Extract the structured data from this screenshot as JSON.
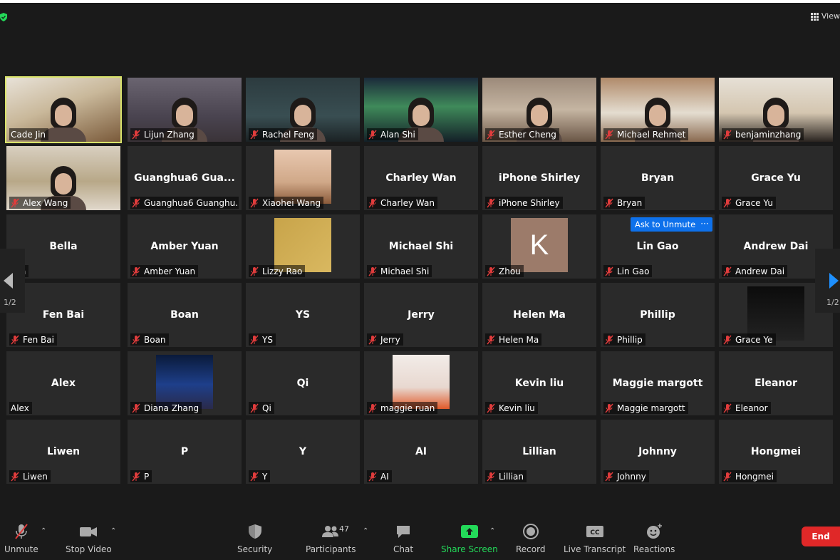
{
  "top_bar": {
    "view_label": "View"
  },
  "pagination": {
    "left_page": "1/2",
    "right_page": "1/2"
  },
  "ask_to_unmute": {
    "label": "Ask to Unmute",
    "more_label": "···"
  },
  "tiles": [
    {
      "name": "Cade Jin",
      "big": "",
      "video": true,
      "muted": false
    },
    {
      "name": "Lijun Zhang",
      "big": "",
      "video": true,
      "muted": true
    },
    {
      "name": "Rachel Feng",
      "big": "",
      "video": true,
      "muted": true
    },
    {
      "name": "Alan Shi",
      "big": "",
      "video": true,
      "muted": true
    },
    {
      "name": "Esther Cheng",
      "big": "",
      "video": true,
      "muted": true
    },
    {
      "name": "Michael Rehmet",
      "big": "",
      "video": true,
      "muted": true
    },
    {
      "name": "benjaminzhang",
      "big": "",
      "video": true,
      "muted": true
    },
    {
      "name": "Alex Wang",
      "big": "",
      "video": true,
      "muted": true
    },
    {
      "name": "Guanghua6 Guanghu...",
      "big": "Guanghua6  Gua...",
      "video": false,
      "muted": true
    },
    {
      "name": "Xiaohei Wang",
      "big": "",
      "video": false,
      "thumb": true,
      "muted": true
    },
    {
      "name": "Charley Wan",
      "big": "Charley Wan",
      "video": false,
      "muted": true
    },
    {
      "name": "iPhone Shirley",
      "big": "iPhone Shirley",
      "video": false,
      "muted": true
    },
    {
      "name": "Bryan",
      "big": "Bryan",
      "video": false,
      "muted": true
    },
    {
      "name": "Grace Yu",
      "big": "Grace Yu",
      "video": false,
      "muted": true
    },
    {
      "name": "ella",
      "big": "Bella",
      "video": false,
      "muted": false
    },
    {
      "name": "Amber Yuan",
      "big": "Amber Yuan",
      "video": false,
      "muted": true
    },
    {
      "name": "Lizzy Rao",
      "big": "",
      "video": false,
      "thumb": true,
      "muted": true
    },
    {
      "name": "Michael Shi",
      "big": "Michael Shi",
      "video": false,
      "muted": true
    },
    {
      "name": "Zhou",
      "big": "",
      "video": false,
      "avatar_letter": "K",
      "muted": true
    },
    {
      "name": "Lin Gao",
      "big": "Lin Gao",
      "video": false,
      "muted": true
    },
    {
      "name": "Andrew Dai",
      "big": "Andrew Dai",
      "video": false,
      "muted": true
    },
    {
      "name": "Fen Bai",
      "big": "Fen Bai",
      "video": false,
      "muted": true
    },
    {
      "name": "Boan",
      "big": "Boan",
      "video": false,
      "muted": true
    },
    {
      "name": "YS",
      "big": "YS",
      "video": false,
      "muted": true
    },
    {
      "name": "Jerry",
      "big": "Jerry",
      "video": false,
      "muted": true
    },
    {
      "name": "Helen Ma",
      "big": "Helen Ma",
      "video": false,
      "muted": true
    },
    {
      "name": "Phillip",
      "big": "Phillip",
      "video": false,
      "muted": true
    },
    {
      "name": "Grace Ye",
      "big": "",
      "video": false,
      "thumb": true,
      "muted": true
    },
    {
      "name": "Alex",
      "big": "Alex",
      "video": false,
      "muted": false
    },
    {
      "name": "Diana Zhang",
      "big": "",
      "video": false,
      "thumb": true,
      "muted": true
    },
    {
      "name": "Qi",
      "big": "Qi",
      "video": false,
      "muted": true
    },
    {
      "name": "maggie ruan",
      "big": "",
      "video": false,
      "thumb": true,
      "muted": true
    },
    {
      "name": "Kevin liu",
      "big": "Kevin liu",
      "video": false,
      "muted": true
    },
    {
      "name": "Maggie margott",
      "big": "Maggie margott",
      "video": false,
      "muted": true
    },
    {
      "name": "Eleanor",
      "big": "Eleanor",
      "video": false,
      "muted": true
    },
    {
      "name": "Liwen",
      "big": "Liwen",
      "video": false,
      "muted": true
    },
    {
      "name": "P",
      "big": "P",
      "video": false,
      "muted": true
    },
    {
      "name": "Y",
      "big": "Y",
      "video": false,
      "muted": true
    },
    {
      "name": "AI",
      "big": "AI",
      "video": false,
      "muted": true
    },
    {
      "name": "Lillian",
      "big": "Lillian",
      "video": false,
      "muted": true
    },
    {
      "name": "Johnny",
      "big": "Johnny",
      "video": false,
      "muted": true
    },
    {
      "name": "Hongmei",
      "big": "Hongmei",
      "video": false,
      "muted": true
    }
  ],
  "toolbar": {
    "unmute": "Unmute",
    "stop_video": "Stop Video",
    "security": "Security",
    "participants": "Participants",
    "participants_count": "47",
    "chat": "Chat",
    "share_screen": "Share Screen",
    "record": "Record",
    "live_transcript": "Live Transcript",
    "reactions": "Reactions",
    "end": "End"
  },
  "colors": {
    "background": "#1a1a1a",
    "tile": "#2a2a2a",
    "active_speaker": "#d9e36a",
    "accent_blue": "#0e71eb",
    "share_green": "#23d959",
    "end_red": "#e02828",
    "mute_red": "#e03c3c"
  },
  "icons": [
    "shield-check-icon",
    "grid-view-icon",
    "muted-mic-icon",
    "video-camera-icon",
    "security-shield-icon",
    "participants-icon",
    "chat-bubble-icon",
    "share-screen-arrow-icon",
    "record-icon",
    "closed-caption-icon",
    "reactions-smiley-icon",
    "caret-up-icon",
    "left-arrow-icon",
    "right-arrow-icon"
  ]
}
